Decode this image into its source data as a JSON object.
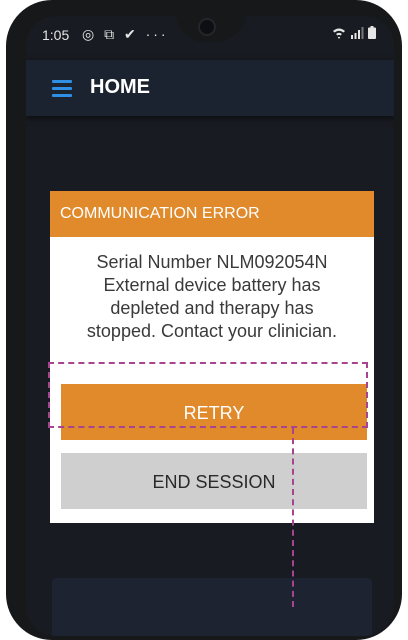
{
  "status_bar": {
    "time": "1:05",
    "left_icons": "◎ ⧉ ✔ ···"
  },
  "app_bar": {
    "title": "HOME",
    "menu_icon": "hamburger-menu-icon"
  },
  "dialog": {
    "title": "COMMUNICATION ERROR",
    "message_lines": [
      "Serial Number NLM092054N",
      "External device battery has",
      "depleted and therapy has",
      "stopped. Contact your clinician."
    ],
    "retry_label": "RETRY",
    "end_session_label": "END SESSION"
  },
  "colors": {
    "accent_orange": "#e08a2c",
    "highlight_magenta": "#a8448f",
    "menu_blue": "#2f8fe5",
    "app_bar_bg": "#1c2330"
  }
}
